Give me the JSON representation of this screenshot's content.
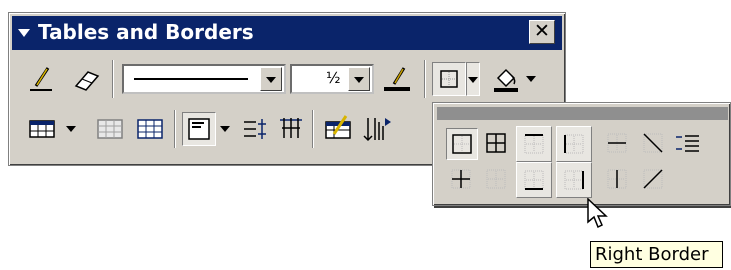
{
  "toolbar": {
    "title": "Tables and Borders",
    "close_glyph": "✕",
    "line_weight_value": "½",
    "buttons": [
      "draw-table",
      "eraser",
      "line-style",
      "line-weight",
      "border-color",
      "outside-border",
      "shading-color",
      "insert-table",
      "merge-cells",
      "split-cells",
      "align",
      "distribute-rows",
      "distribute-columns",
      "table-autoformat",
      "sort"
    ]
  },
  "palette": {
    "items": [
      {
        "name": "outside-border",
        "pressed": true
      },
      {
        "name": "all-borders",
        "pressed": false
      },
      {
        "name": "top-border",
        "pressed": true
      },
      {
        "name": "left-border",
        "pressed": true
      },
      {
        "name": "inside-horizontal-border",
        "pressed": false
      },
      {
        "name": "diagonal-down-border",
        "pressed": false
      },
      {
        "name": "horizontal-line",
        "pressed": false
      },
      {
        "name": "inside-border",
        "pressed": false
      },
      {
        "name": "no-border",
        "pressed": false
      },
      {
        "name": "bottom-border",
        "pressed": true
      },
      {
        "name": "right-border",
        "pressed": true
      },
      {
        "name": "inside-vertical-border",
        "pressed": false
      },
      {
        "name": "diagonal-up-border",
        "pressed": false
      }
    ]
  },
  "tooltip": {
    "text": "Right Border"
  },
  "colors": {
    "title_bg": "#0a246a",
    "face": "#d4d0c8",
    "tooltip_bg": "#ffffe1",
    "pen": "#c8a000"
  }
}
